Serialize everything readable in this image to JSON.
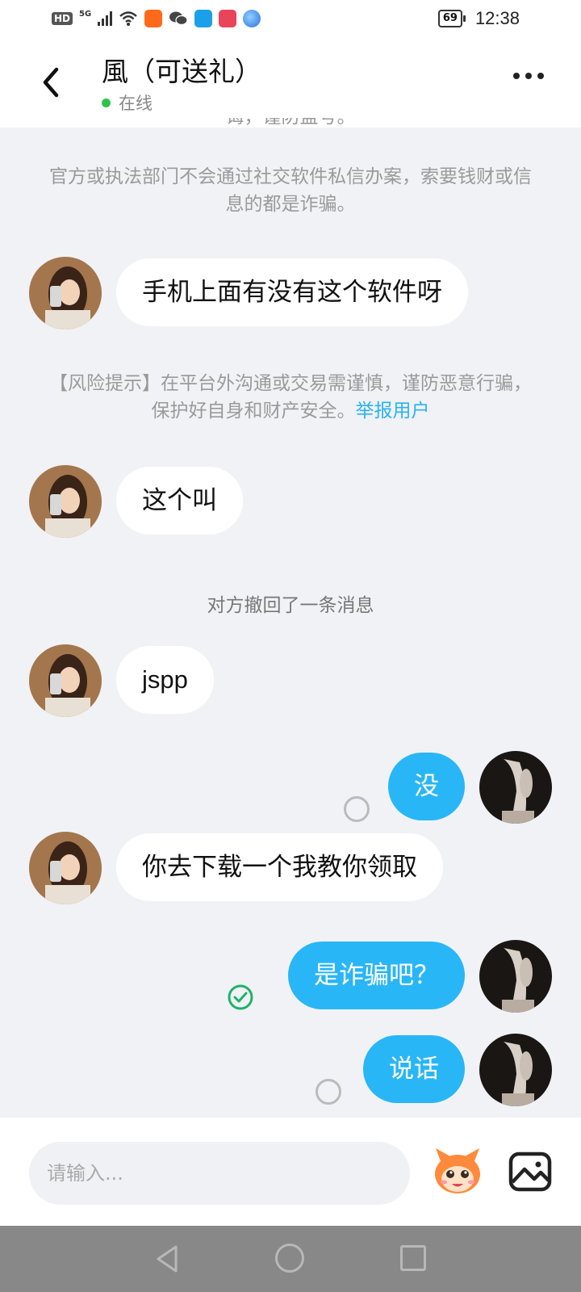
{
  "status_bar": {
    "hd": "HD",
    "network": "5G",
    "battery": "69",
    "time": "12:38"
  },
  "header": {
    "title": "風（可送礼）",
    "status": "在线"
  },
  "notices": {
    "cut_line": "诲，谨防盗号。",
    "official": "官方或执法部门不会通过社交软件私信办案，索要钱财或信息的都是诈骗。",
    "risk_text": "【风险提示】在平台外沟通或交易需谨慎，谨防恶意行骗，保护好自身和财产安全。",
    "risk_link": "举报用户",
    "recall": "对方撤回了一条消息"
  },
  "messages": [
    {
      "side": "left",
      "text": "手机上面有没有这个软件呀"
    },
    {
      "side": "left",
      "text": "这个叫"
    },
    {
      "side": "left",
      "text": "jspp"
    },
    {
      "side": "right",
      "text": "没",
      "status": "pending"
    },
    {
      "side": "left",
      "text": "你去下载一个我教你领取"
    },
    {
      "side": "right",
      "text": "是诈骗吧？",
      "status": "read"
    },
    {
      "side": "right",
      "text": "说话",
      "status": "pending"
    }
  ],
  "input": {
    "placeholder": "请输入..."
  },
  "colors": {
    "accent": "#29b6f6",
    "online": "#2ec44a",
    "link": "#2ab3ef",
    "background": "#f1f2f6"
  },
  "icons": {
    "back": "chevron-left-icon",
    "more": "more-dots-icon",
    "emoji": "emoji-mascot-icon",
    "image": "image-icon"
  }
}
